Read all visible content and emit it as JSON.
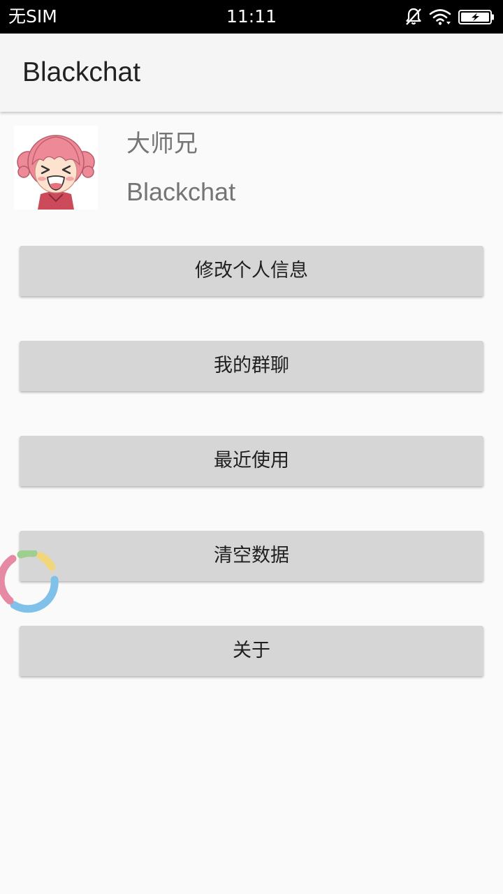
{
  "status_bar": {
    "carrier": "无SIM",
    "time": "11:11",
    "icons": [
      "bell-muted-icon",
      "wifi-icon",
      "battery-charging-icon"
    ]
  },
  "app_bar": {
    "title": "Blackchat"
  },
  "profile": {
    "name": "大师兄",
    "subtitle": "Blackchat",
    "avatar": "cartoon-girl-avatar"
  },
  "menu": {
    "items": [
      {
        "label": "修改个人信息"
      },
      {
        "label": "我的群聊"
      },
      {
        "label": "最近使用"
      },
      {
        "label": "清空数据"
      },
      {
        "label": "关于"
      }
    ]
  },
  "colors": {
    "status_bar": "#000000",
    "app_bar": "#f5f5f5",
    "background": "#fafafa",
    "button": "#d6d6d6",
    "secondary_text": "#757575"
  }
}
